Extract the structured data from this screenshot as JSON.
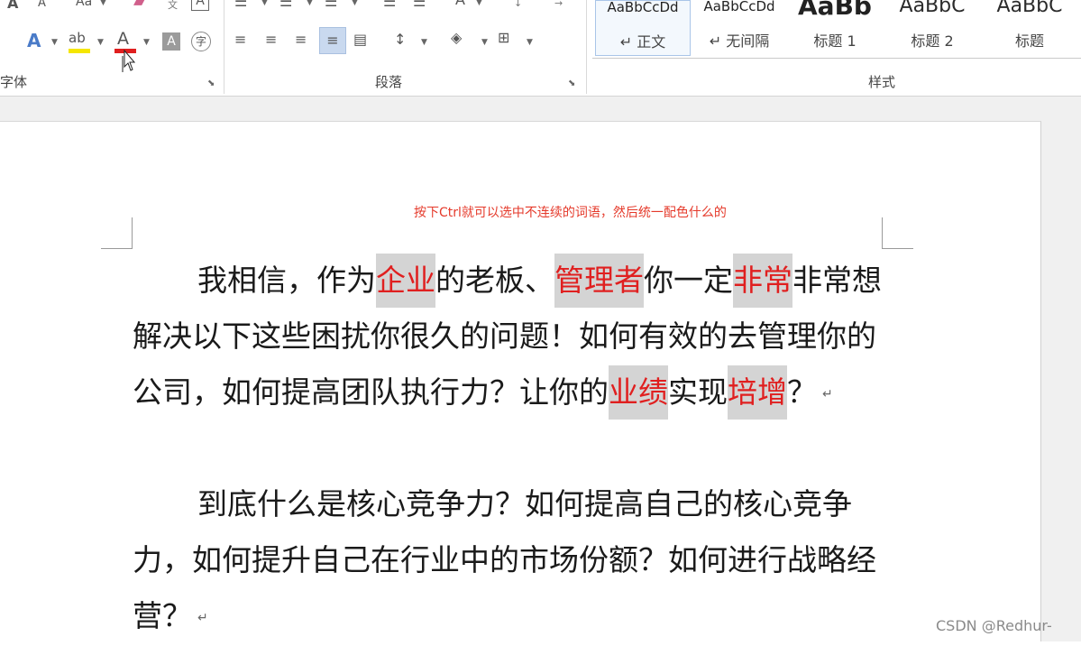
{
  "ribbon": {
    "groups": {
      "font_label": "字体",
      "paragraph_label": "段落",
      "styles_label": "样式"
    },
    "styles": [
      {
        "sample": "AaBbCcDd",
        "name": "↵ 正文"
      },
      {
        "sample": "AaBbCcDd",
        "name": "↵ 无间隔"
      },
      {
        "sample": "AaBb",
        "name": "标题 1"
      },
      {
        "sample": "AaBbC",
        "name": "标题 2"
      },
      {
        "sample": "AaBbC",
        "name": "标题"
      }
    ],
    "font_icons": {
      "font_size_up": "A",
      "font_size_down": "A",
      "change_case": "Aa",
      "text_effects": "A",
      "highlight": "ab",
      "font_color": "A",
      "char_shading": "A",
      "enclose_char": "字",
      "char_border": "A",
      "phonetic": "文"
    },
    "colors": {
      "highlight_bar": "#f5e600",
      "font_color_bar": "#e01f1f",
      "selected_style_border": "#a9c5e8"
    }
  },
  "document": {
    "annotation": "按下Ctrl就可以选中不连续的词语，然后统一配色什么的",
    "para1": {
      "t1": "我相信，作为",
      "s1": "企业",
      "t2": "的老板、",
      "s2": "管理者",
      "t3": "你一定",
      "s3": "非常",
      "t4": "非常想解决以下这些困扰你很久的问题！如何有效的去管理你的公司，如何提高团队执行力？让你的",
      "s4": "业绩",
      "t5": "实现",
      "s5": "培增",
      "t6": "？"
    },
    "para2": {
      "text": "到底什么是核心竞争力？如何提高自己的核心竞争力，如何提升自己在行业中的市场份额？如何进行战略经营？"
    },
    "paragraph_mark": "↵",
    "selection_colors": {
      "background": "#d4d4d4",
      "text": "#e01f1f"
    }
  },
  "watermark": "CSDN @Redhur-"
}
